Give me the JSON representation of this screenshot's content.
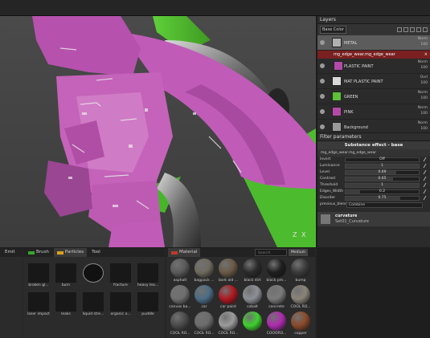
{
  "layers_panel": {
    "title": "Layers",
    "channel": "Base Color",
    "layers": [
      {
        "name": "METAL",
        "blend": "Norm",
        "opacity": "100",
        "color": "#b0b0b0",
        "selected": true
      },
      {
        "name": "PLASTIC PAINT",
        "blend": "Norm",
        "opacity": "100",
        "color": "#b44aa8"
      },
      {
        "name": "MAT PLASTIC PAINT",
        "blend": "Ovrl",
        "opacity": "100",
        "color": "#d8d8d8"
      },
      {
        "name": "GREEN",
        "blend": "Norm",
        "opacity": "100",
        "color": "#5fbf3a"
      },
      {
        "name": "PINK",
        "blend": "Norm",
        "opacity": "100",
        "color": "#b44aa8"
      },
      {
        "name": "Background",
        "blend": "Norm",
        "opacity": "100",
        "color": "#9a9a9a"
      }
    ],
    "effect": {
      "name": "mg_edge_wear.mg_edge_wear",
      "close": "×"
    }
  },
  "filter_panel": {
    "title": "Filter parameters",
    "effect_header": "Substance effect - base",
    "effect_name": "mg_edge_wear.mg_edge_wear",
    "params": [
      {
        "label": "Invert",
        "value": "Off",
        "fraction": 0
      },
      {
        "label": "Luminance",
        "value": "1",
        "fraction": 1
      },
      {
        "label": "Level",
        "value": "0.69",
        "fraction": 0.69
      },
      {
        "label": "Contrast",
        "value": "0.65",
        "fraction": 0.65
      },
      {
        "label": "Threshold",
        "value": "1",
        "fraction": 1
      },
      {
        "label": "Edges_Width",
        "value": "0.2",
        "fraction": 0.2
      },
      {
        "label": "Disorder",
        "value": "0.75",
        "fraction": 0.75
      }
    ],
    "previous_blend": {
      "label": "previous_blend",
      "value": "Combine"
    },
    "curvature": {
      "name": "curvature",
      "source": "Set01_Curvature"
    }
  },
  "viewport": {
    "axis_z": "Z",
    "axis_x": "X"
  },
  "shelf": {
    "tabs": [
      "Brush",
      "Particles",
      "Tool"
    ],
    "left_label": "Emit",
    "items": [
      "broken gl...",
      "burn",
      "",
      "fracture",
      "heavy lea...",
      "laser impact",
      "leaks",
      "liquid stre...",
      "organic o...",
      "puddle"
    ]
  },
  "materials": {
    "tab": "Material",
    "search": "Search",
    "size": "Medium",
    "items": [
      {
        "name": "asphalt",
        "color": "#5a5a5a"
      },
      {
        "name": "bagpack ...",
        "color": "#6e6a5e"
      },
      {
        "name": "bark old ...",
        "color": "#6a5a45"
      },
      {
        "name": "black dirt",
        "color": "#2a2a2a"
      },
      {
        "name": "black pm...",
        "color": "#1e1e1e"
      },
      {
        "name": "bump",
        "color": "#3a3a3a"
      },
      {
        "name": "canvas ba...",
        "color": "#6f6f6f"
      },
      {
        "name": "car",
        "color": "#4c6c84"
      },
      {
        "name": "car paint",
        "color": "#b01820"
      },
      {
        "name": "cobalt",
        "color": "#8c9096"
      },
      {
        "name": "concrete",
        "color": "#7a7a7a"
      },
      {
        "name": "COOL RO...",
        "color": "#8a8478"
      },
      {
        "name": "COOL RO...",
        "color": "#4a4a4a"
      },
      {
        "name": "COOL RO...",
        "color": "#6c6c6c"
      },
      {
        "name": "COOL RO...",
        "color": "#9c9c9c"
      },
      {
        "name": "",
        "color": "#3fd02e"
      },
      {
        "name": "COOORO...",
        "color": "#b02ab0"
      },
      {
        "name": "copper",
        "color": "#8a4a2a"
      }
    ]
  }
}
